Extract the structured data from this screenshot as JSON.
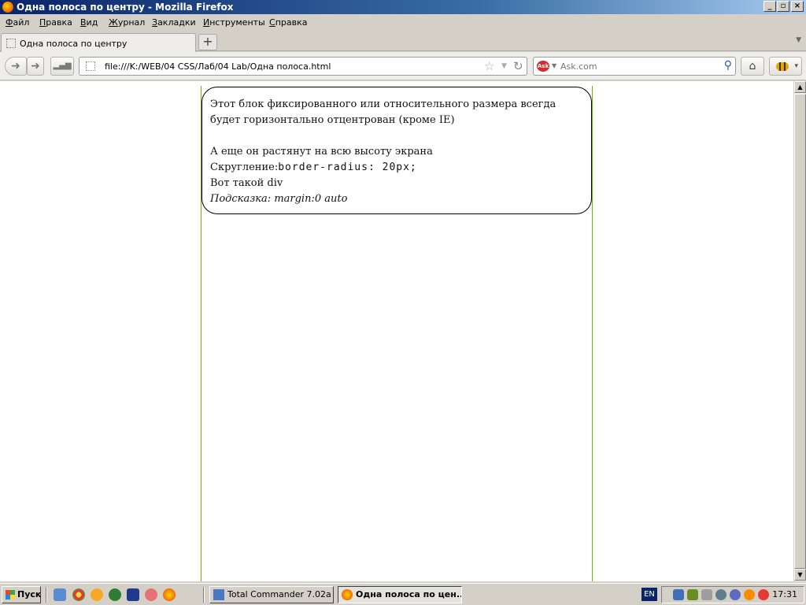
{
  "window": {
    "title": "Одна полоса по центру - Mozilla Firefox"
  },
  "menu": [
    "Файл",
    "Правка",
    "Вид",
    "Журнал",
    "Закладки",
    "Инструменты",
    "Справка"
  ],
  "tab": {
    "label": "Одна полоса по центру",
    "new_tab": "+"
  },
  "nav": {
    "url": "file:///K:/WEB/04 CSS/Лаб/04 Lab/Одна полоса.html",
    "search_placeholder": "Ask.com"
  },
  "page": {
    "line1": "Этот блок фиксированного или относительного размера всегда будет горизонтально отцентрован (кроме IE)",
    "line2": "А еще он растянут на всю высоту экрана",
    "line3_label": "Скругление:",
    "line3_code": "border-radius: 20px;",
    "line4": "Вот такой div",
    "line5": "Подсказка: margin:0 auto"
  },
  "taskbar": {
    "start": "Пуск",
    "tasks": [
      "Total Commander 7.02a ...",
      "Одна полоса по цен..."
    ],
    "lang": "EN",
    "clock": "17:31"
  },
  "colors": {
    "column_border": "#77b300",
    "title_bar": "#0a246a"
  }
}
